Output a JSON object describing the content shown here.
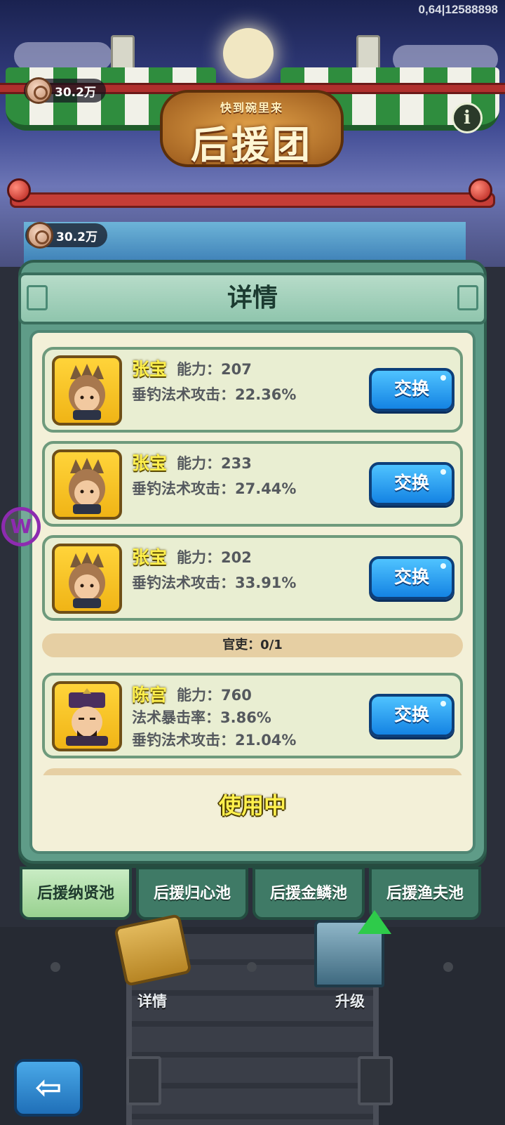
{
  "status": {
    "id_text": "0,64|12588898"
  },
  "header": {
    "banner_subtitle": "快到碗里来",
    "banner_title": "后援团",
    "coins_top": "30.2万",
    "coins_second": "30.2万",
    "info_label": "i"
  },
  "dialog": {
    "title": "详情",
    "cards": [
      {
        "name": "张宝",
        "ability": "能力：207",
        "lines": [
          "垂钓法术攻击：22.36%"
        ],
        "button": "交换"
      },
      {
        "name": "张宝",
        "ability": "能力：233",
        "lines": [
          "垂钓法术攻击：27.44%"
        ],
        "button": "交换"
      },
      {
        "name": "张宝",
        "ability": "能力：202",
        "lines": [
          "垂钓法术攻击：33.91%"
        ],
        "button": "交换"
      },
      {
        "name": "陈宫",
        "ability": "能力：760",
        "lines": [
          "法术暴击率：3.86%",
          "垂钓法术攻击：21.04%"
        ],
        "button": "交换"
      }
    ],
    "sections": {
      "officials": "官吏：0/1"
    },
    "in_use_label": "使用中"
  },
  "tabs": [
    {
      "label": "后援纳贤池",
      "active": true
    },
    {
      "label": "后援归心池",
      "active": false
    },
    {
      "label": "后援金鳞池",
      "active": false
    },
    {
      "label": "后援渔夫池",
      "active": false
    }
  ],
  "bottom": {
    "details_label": "详情",
    "upgrade_label": "升级",
    "back_label": "⇦"
  },
  "colors": {
    "dialog_frame": "#5f9c88",
    "card_bg": "#e9eed2",
    "button_blue": "#1483e3",
    "name_yellow": "#fff04c"
  }
}
